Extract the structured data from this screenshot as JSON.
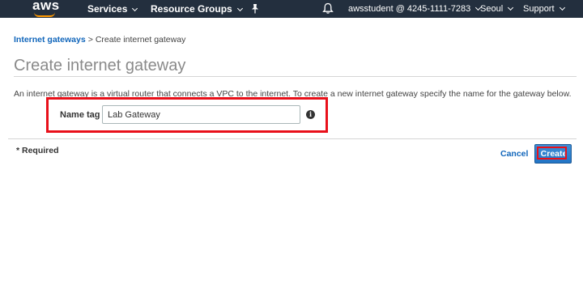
{
  "nav": {
    "logo": "aws",
    "services": "Services",
    "resource_groups": "Resource Groups",
    "account": "awsstudent @ 4245-1111-7283",
    "region": "Seoul",
    "support": "Support"
  },
  "breadcrumb": {
    "parent": "Internet gateways",
    "separator": ">",
    "current": "Create internet gateway"
  },
  "page": {
    "title": "Create internet gateway",
    "description": "An internet gateway is a virtual router that connects a VPC to the internet. To create a new internet gateway specify the name for the gateway below."
  },
  "form": {
    "name_label": "Name tag",
    "name_value": "Lab Gateway",
    "info_glyph": "i"
  },
  "footer": {
    "required": "* Required",
    "cancel": "Cancel",
    "create": "Create"
  },
  "colors": {
    "nav_bg": "#232f3e",
    "link": "#1166bb",
    "primary_button": "#2275c6",
    "highlight": "#e8101a",
    "logo_smile": "#ff9900"
  },
  "icons": [
    "aws-logo",
    "chevron-down-icon",
    "pin-icon",
    "bell-icon",
    "info-icon"
  ]
}
